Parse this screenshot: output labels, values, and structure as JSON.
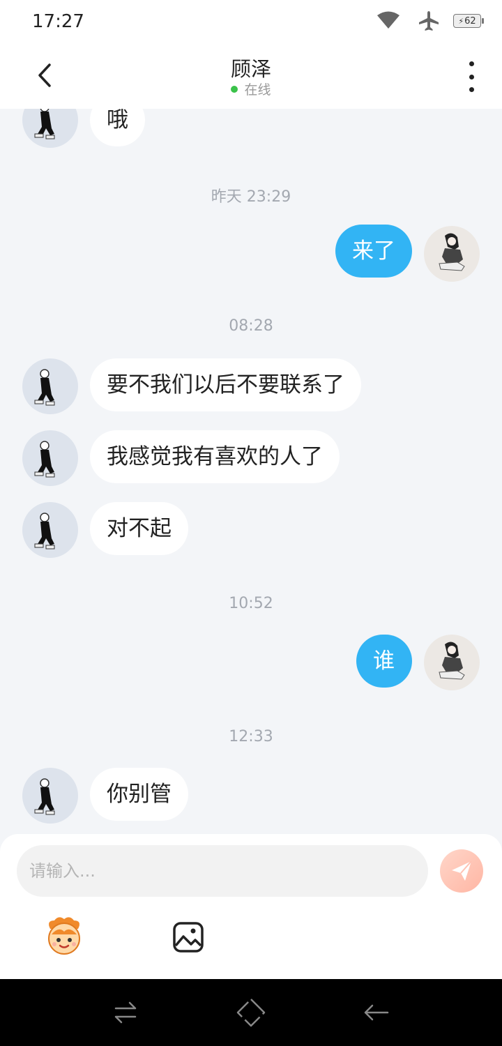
{
  "status_bar": {
    "time": "17:27",
    "battery": "62"
  },
  "header": {
    "title": "顾泽",
    "status": "在线"
  },
  "messages": [
    {
      "type": "text",
      "from": "peer",
      "text": "哦"
    },
    {
      "type": "time",
      "text": "昨天 23:29"
    },
    {
      "type": "text",
      "from": "self",
      "text": "来了"
    },
    {
      "type": "time",
      "text": "08:28"
    },
    {
      "type": "text",
      "from": "peer",
      "text": "要不我们以后不要联系了"
    },
    {
      "type": "text",
      "from": "peer",
      "text": "我感觉我有喜欢的人了"
    },
    {
      "type": "text",
      "from": "peer",
      "text": "对不起"
    },
    {
      "type": "time",
      "text": "10:52"
    },
    {
      "type": "text",
      "from": "self",
      "text": "谁"
    },
    {
      "type": "time",
      "text": "12:33"
    },
    {
      "type": "text",
      "from": "peer",
      "text": "你别管"
    }
  ],
  "input": {
    "placeholder": "请输入..."
  },
  "toolbar": {
    "icons": [
      "emoji-icon",
      "image-icon"
    ]
  },
  "colors": {
    "self_bubble": "#32b4f4",
    "peer_bubble": "#ffffff",
    "online": "#3bc24a",
    "send_button": "#ffb6a4"
  }
}
